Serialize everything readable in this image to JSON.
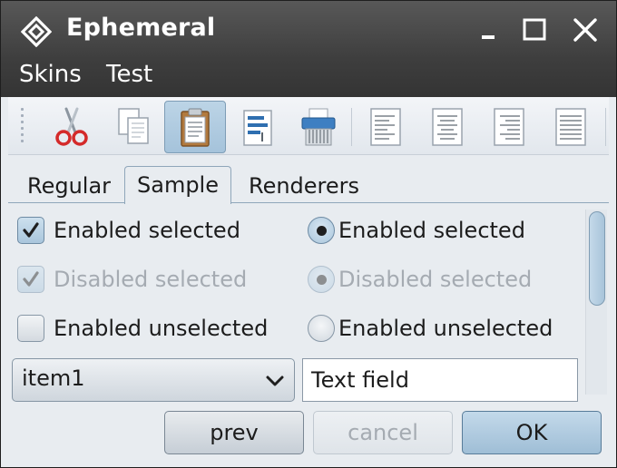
{
  "window": {
    "title": "Ephemeral",
    "logo_icon": "diamond-cross-icon",
    "controls": [
      "minimize-icon",
      "maximize-icon",
      "close-icon"
    ]
  },
  "menu": {
    "items": [
      "Skins",
      "Test"
    ]
  },
  "toolbar": {
    "buttons": [
      {
        "icon": "cut-icon",
        "active": false
      },
      {
        "icon": "copy-icon",
        "active": false
      },
      {
        "icon": "paste-icon",
        "active": true
      },
      {
        "icon": "find-icon",
        "active": false
      },
      {
        "icon": "shred-icon",
        "active": false
      },
      {
        "icon": "align-left-icon",
        "active": false
      },
      {
        "icon": "align-center-icon",
        "active": false
      },
      {
        "icon": "align-right-icon",
        "active": false
      },
      {
        "icon": "align-justify-icon",
        "active": false
      }
    ]
  },
  "tabs": {
    "items": [
      "Regular",
      "Sample",
      "Renderers"
    ],
    "selected": "Sample"
  },
  "sample": {
    "checkboxes": [
      {
        "label": "Enabled selected",
        "checked": true,
        "enabled": true
      },
      {
        "label": "Disabled selected",
        "checked": true,
        "enabled": false
      },
      {
        "label": "Enabled unselected",
        "checked": false,
        "enabled": true
      }
    ],
    "radios": [
      {
        "label": "Enabled selected",
        "selected": true,
        "enabled": true
      },
      {
        "label": "Disabled selected",
        "selected": true,
        "enabled": false
      },
      {
        "label": "Enabled unselected",
        "selected": false,
        "enabled": true
      }
    ],
    "combo": {
      "value": "item1"
    },
    "text_field": {
      "value": "Text field"
    }
  },
  "buttons": {
    "prev": "prev",
    "cancel": "cancel",
    "ok": "OK"
  },
  "colors": {
    "title_bar": "#4a4a4a",
    "accent": "#a9c6dc",
    "background": "#e8ecf0"
  }
}
